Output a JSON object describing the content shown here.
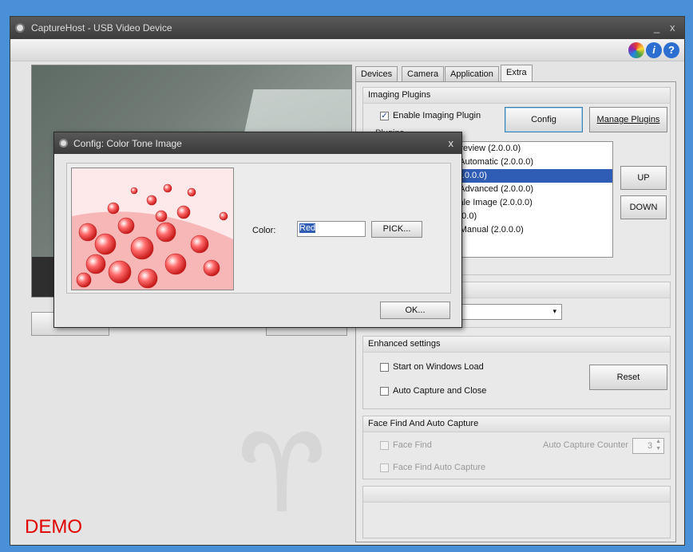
{
  "window": {
    "title": "CaptureHost - USB Video Device",
    "minimize": "_",
    "close": "x"
  },
  "toolbar": {
    "help_glyph": "?",
    "info_glyph": "i"
  },
  "tabs": [
    {
      "label": "Devices"
    },
    {
      "label": "Camera"
    },
    {
      "label": "Application"
    },
    {
      "label": "Extra"
    }
  ],
  "imaging_plugins": {
    "header": "Imaging Plugins",
    "enable_label": "Enable Imaging Plugin",
    "enable_checked": true,
    "config_button": "Config",
    "manage_button": "Manage Plugins",
    "plugins_label": "Plugins",
    "items": [
      {
        "label": "Preview (2.0.0.0)"
      },
      {
        "label": "- Automatic (2.0.0.0)"
      },
      {
        "label": "(2.0.0.0)"
      },
      {
        "label": "- Advanced (2.0.0.0)"
      },
      {
        "label": "cale Image (2.0.0.0)"
      },
      {
        "label": "0.0.0)"
      },
      {
        "label": "- Manual (2.0.0.0)"
      }
    ],
    "selected_index": 2,
    "up_button": "UP",
    "down_button": "DOWN"
  },
  "enhanced": {
    "header": "Enhanced settings",
    "start_on_load": "Start on Windows Load",
    "auto_capture_close": "Auto Capture and Close",
    "reset_button": "Reset"
  },
  "face_find": {
    "header": "Face Find And Auto Capture",
    "face_find": "Face Find",
    "face_find_auto": "Face Find Auto Capture",
    "counter_label": "Auto Capture Counter",
    "counter_value": "3"
  },
  "dialog": {
    "title": "Config: Color Tone Image",
    "close": "x",
    "color_label": "Color:",
    "color_value": "Red",
    "pick_button": "PICK...",
    "ok_button": "OK..."
  },
  "watermark": "DEMO",
  "colors": {
    "accent": "#2f5db5",
    "demo": "#e00000",
    "desktop": "#4a90d9"
  }
}
